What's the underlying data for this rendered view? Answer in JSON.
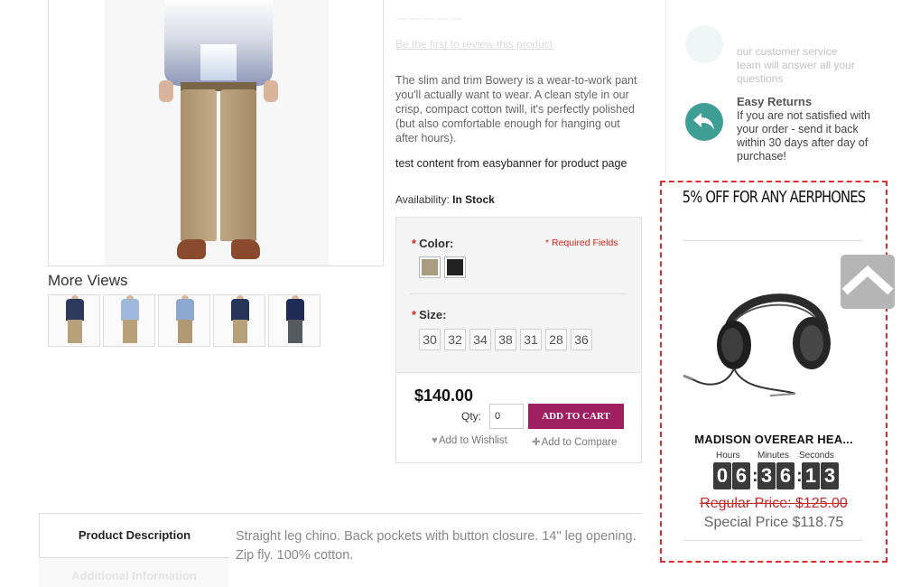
{
  "product": {
    "review_link": "Be the first to review this product",
    "description": "The slim and trim Bowery is a wear-to-work pant you'll actually want to wear. A clean style in our crisp, compact cotton twill, it's perfectly polished (but also comfortable enough for hanging out after hours).",
    "promo_text": "test content from easybanner for product page",
    "availability_label": "Availability:",
    "availability_value": "In Stock",
    "more_views_title": "More Views",
    "thumbnails": [
      "thumb-1",
      "thumb-2",
      "thumb-3",
      "thumb-4",
      "thumb-5"
    ]
  },
  "options": {
    "required_marker": "*",
    "color_label": "Color:",
    "required_note": "* Required Fields",
    "colors": [
      {
        "name": "khaki",
        "hex": "#ab9c81"
      },
      {
        "name": "black",
        "hex": "#222222"
      }
    ],
    "size_label": "Size:",
    "sizes": [
      "30",
      "32",
      "34",
      "38",
      "31",
      "28",
      "36"
    ]
  },
  "cart": {
    "price": "$140.00",
    "qty_label": "Qty:",
    "qty_value": "0",
    "add_to_cart": "ADD TO CART",
    "wishlist": "Add to Wishlist",
    "compare": "Add to Compare"
  },
  "tabs": {
    "active": "Product Description",
    "inactive": "Additional Information",
    "content": "Straight leg chino. Back pockets with button closure. 14\" leg opening. Zip fly. 100% cotton."
  },
  "service": {
    "faded_text": "our customer service team will answer all your questions",
    "returns_title": "Easy Returns",
    "returns_text": "If you are not satisfied with your order - send it back within 30 days after day of purchase!"
  },
  "deal": {
    "title": "5% OFF FOR ANY AERPHONES",
    "product_name": "MADISON OVEREAR HEA...",
    "labels": {
      "hours": "Hours",
      "minutes": "Minutes",
      "seconds": "Seconds"
    },
    "countdown": {
      "hours": [
        "0",
        "6"
      ],
      "minutes": [
        "3",
        "6"
      ],
      "seconds": [
        "1",
        "3"
      ]
    },
    "regular_price": "Regular Price: $125.00",
    "special_price": "Special Price $118.75"
  },
  "colors": {
    "accent": "#a01f61",
    "required": "#d9251c",
    "deal_border": "#e02b2f",
    "returns_icon": "#3e9e96"
  }
}
